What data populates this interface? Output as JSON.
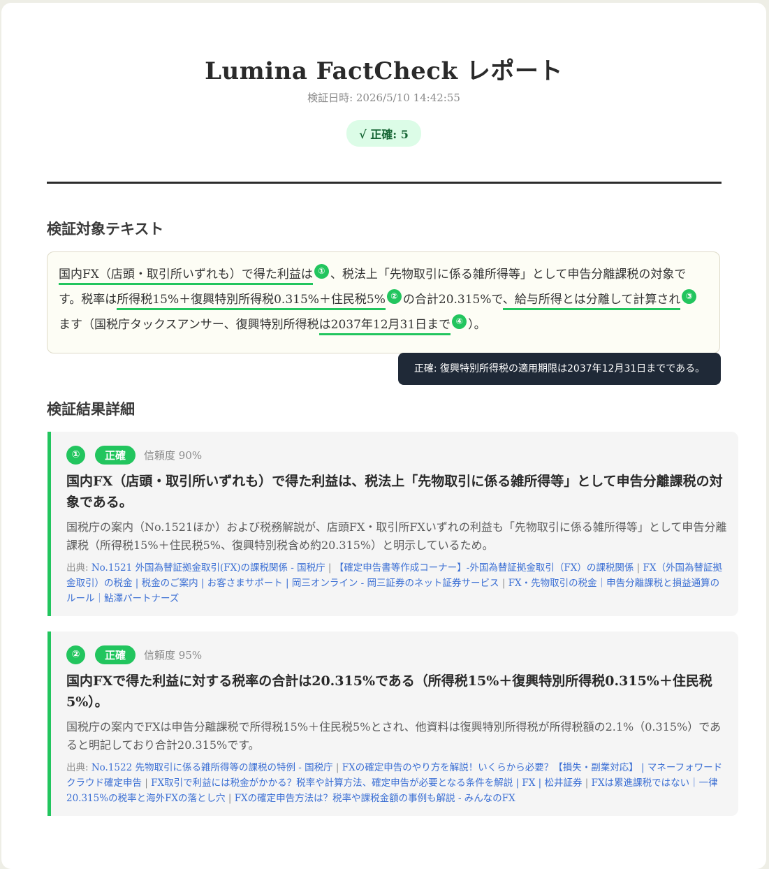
{
  "header": {
    "title": "Lumina FactCheck レポート",
    "date": "検証日時: 2026/5/10 14:42:55",
    "summary_badge": "√ 正確: 5"
  },
  "target_section": {
    "title": "検証対象テキスト",
    "segments": {
      "s1": "国内FX（店頭・取引所いずれも）で得た利益は",
      "m1": "①",
      "s2": "、税法上「先物取引に係る雑所得等」として申告分離課税の対象です。税率は",
      "s3": "所得税15%＋復興特別所得税0.315%＋住民税5%",
      "m2": "②",
      "s4": "の合計20.315%で",
      "s5": "、給与所得とは分離して計算され",
      "m3": "③",
      "s6": "ます（国税庁タックスアンサー、復興特別所得税",
      "s7": "は2037年12月31日まで",
      "m4": "④",
      "s8": "）。"
    },
    "tooltip": "正確: 復興特別所得税の適用期限は2037年12月31日までである。"
  },
  "results_section": {
    "title": "検証結果詳細",
    "cards": [
      {
        "number": "①",
        "verdict": "正確",
        "confidence": "信頼度 90%",
        "claim": "国内FX（店頭・取引所いずれも）で得た利益は、税法上「先物取引に係る雑所得等」として申告分離課税の対象である。",
        "reason": "国税庁の案内（No.1521ほか）および税務解説が、店頭FX・取引所FXいずれの利益も「先物取引に係る雑所得等」として申告分離課税（所得税15%＋住民税5%、復興特別税含め約20.315%）と明示しているため。",
        "sources_label": "出典: ",
        "sources": [
          "No.1521 外国為替証拠金取引(FX)の課税関係 - 国税庁",
          "【確定申告書等作成コーナー】-外国為替証拠金取引（FX）の課税関係",
          "FX（外国為替証拠金取引）の税金 | 税金のご案内 | お客さまサポート | 岡三オンライン - 岡三証券のネット証券サービス",
          "FX・先物取引の税金｜申告分離課税と損益通算のルール｜鮎澤パートナーズ"
        ]
      },
      {
        "number": "②",
        "verdict": "正確",
        "confidence": "信頼度 95%",
        "claim": "国内FXで得た利益に対する税率の合計は20.315%である（所得税15%＋復興特別所得税0.315%＋住民税5%）。",
        "reason": "国税庁の案内でFXは申告分離課税で所得税15%＋住民税5%とされ、他資料は復興特別所得税が所得税額の2.1%（0.315%）であると明記しており合計20.315%です。",
        "sources_label": "出典: ",
        "sources": [
          "No.1522 先物取引に係る雑所得等の課税の特例 - 国税庁",
          "FXの確定申告のやり方を解説！いくらから必要？【損失・副業対応】 | マネーフォワード クラウド確定申告",
          "FX取引で利益には税金がかかる？税率や計算方法、確定申告が必要となる条件を解説 | FX | 松井証券",
          "FXは累進課税ではない｜一律20.315%の税率と海外FXの落とし穴",
          "FXの確定申告方法は？税率や課税金額の事例も解説 - みんなのFX"
        ]
      }
    ]
  },
  "colors": {
    "accent_green": "#22c55e",
    "badge_bg": "#dcfce7",
    "link": "#3b6fd4",
    "tooltip_bg": "#1f2937"
  }
}
